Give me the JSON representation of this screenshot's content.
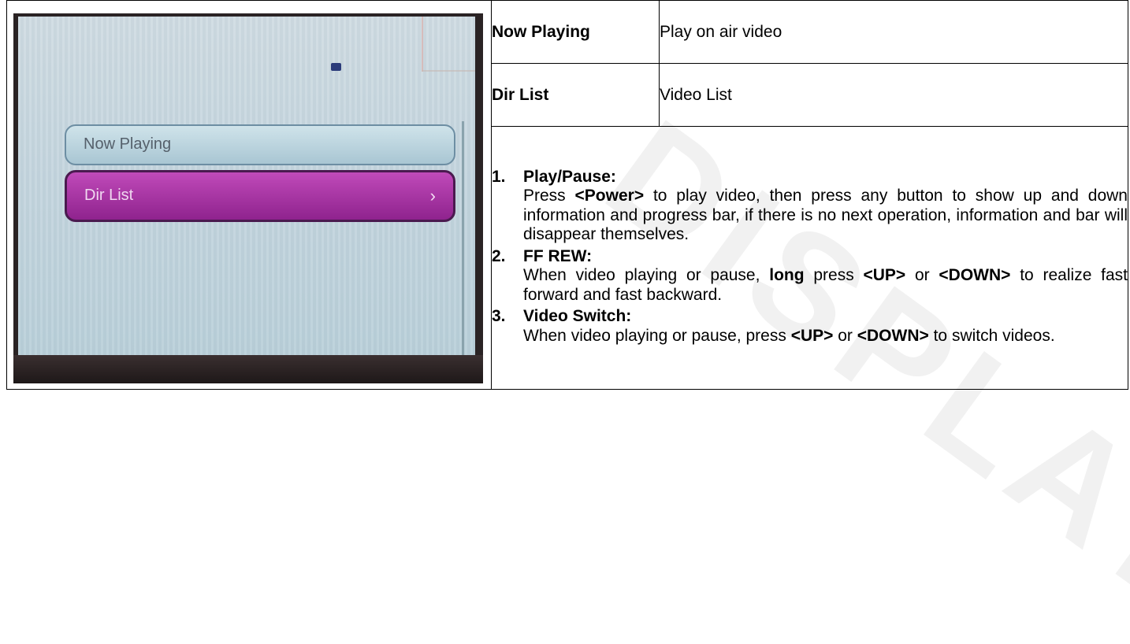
{
  "watermark": "DISPLAY",
  "device_screen": {
    "menu": [
      {
        "label": "Now Playing",
        "selected": false
      },
      {
        "label": "Dir List",
        "selected": true
      }
    ],
    "colors": {
      "selected": "#9b2c98",
      "unselected": "#bcd6e0"
    }
  },
  "rows": [
    {
      "label": "Now Playing",
      "value": "Play on air video"
    },
    {
      "label": "Dir List",
      "value": "Video List"
    }
  ],
  "steps": [
    {
      "number": "1.",
      "title": "Play/Pause:",
      "body": [
        {
          "t": "Press ",
          "b": false
        },
        {
          "t": "<Power>",
          "b": true
        },
        {
          "t": "  to play video, then press any button to show up and down information and progress bar, if there is no next operation, information and bar will disappear themselves.",
          "b": false
        }
      ]
    },
    {
      "number": "2.",
      "title": "FF REW:",
      "body": [
        {
          "t": "When video playing or pause, ",
          "b": false
        },
        {
          "t": "long",
          "b": true
        },
        {
          "t": " press ",
          "b": false
        },
        {
          "t": "<UP>",
          "b": true
        },
        {
          "t": " or ",
          "b": false
        },
        {
          "t": "<DOWN>",
          "b": true
        },
        {
          "t": " to realize fast forward and fast backward.",
          "b": false
        }
      ]
    },
    {
      "number": "3.",
      "title": "Video Switch:",
      "body": [
        {
          "t": "When video playing or pause, press ",
          "b": false
        },
        {
          "t": "<UP>",
          "b": true
        },
        {
          "t": " or ",
          "b": false
        },
        {
          "t": "<DOWN>",
          "b": true
        },
        {
          "t": " to switch videos.",
          "b": false
        }
      ]
    }
  ]
}
